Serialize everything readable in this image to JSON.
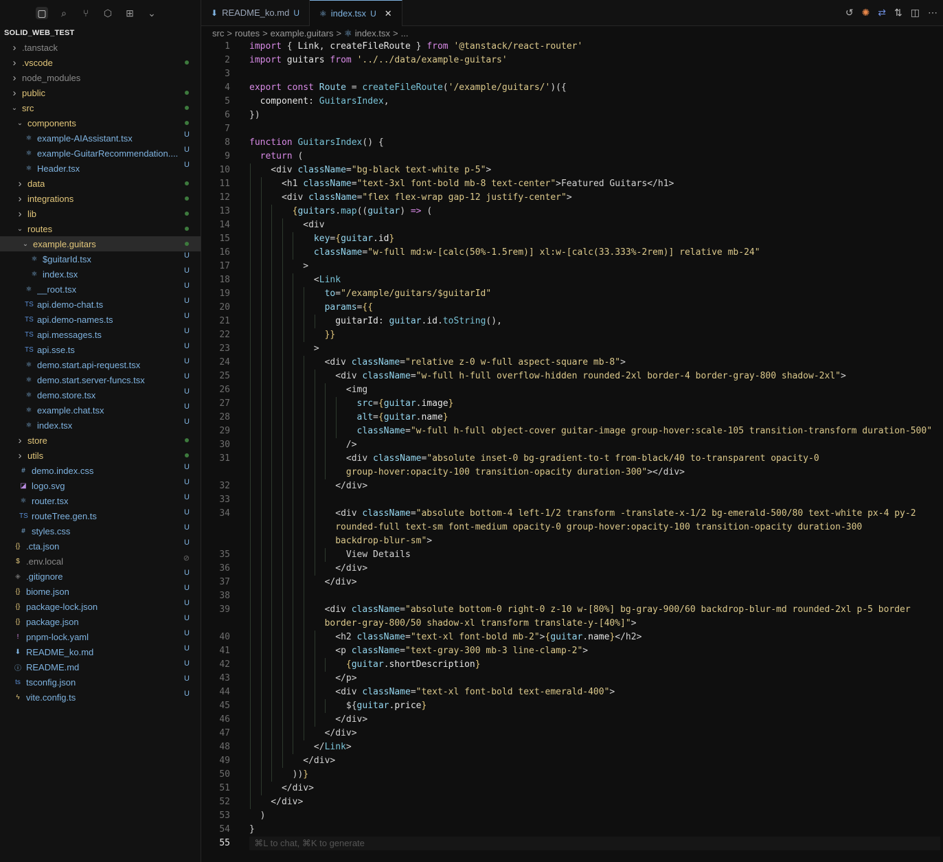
{
  "project": "SOLID_WEB_TEST",
  "tree": [
    {
      "name": ".tanstack",
      "depth": 0,
      "folder": true,
      "open": false,
      "style": "dim",
      "mark": ""
    },
    {
      "name": ".vscode",
      "depth": 0,
      "folder": true,
      "open": false,
      "style": "mod",
      "mark": "dot"
    },
    {
      "name": "node_modules",
      "depth": 0,
      "folder": true,
      "open": false,
      "style": "dim",
      "mark": ""
    },
    {
      "name": "public",
      "depth": 0,
      "folder": true,
      "open": false,
      "style": "mod",
      "mark": "dot"
    },
    {
      "name": "src",
      "depth": 0,
      "folder": true,
      "open": true,
      "style": "mod",
      "mark": "dot"
    },
    {
      "name": "components",
      "depth": 1,
      "folder": true,
      "open": true,
      "style": "mod",
      "mark": "dot"
    },
    {
      "name": "example-AIAssistant.tsx",
      "depth": 2,
      "folder": false,
      "icon": "⚛",
      "style": "new",
      "mark": "U"
    },
    {
      "name": "example-GuitarRecommendation....",
      "depth": 2,
      "folder": false,
      "icon": "⚛",
      "style": "new",
      "mark": "U"
    },
    {
      "name": "Header.tsx",
      "depth": 2,
      "folder": false,
      "icon": "⚛",
      "style": "new",
      "mark": "U"
    },
    {
      "name": "data",
      "depth": 1,
      "folder": true,
      "open": false,
      "style": "mod",
      "mark": "dot"
    },
    {
      "name": "integrations",
      "depth": 1,
      "folder": true,
      "open": false,
      "style": "mod",
      "mark": "dot"
    },
    {
      "name": "lib",
      "depth": 1,
      "folder": true,
      "open": false,
      "style": "mod",
      "mark": "dot"
    },
    {
      "name": "routes",
      "depth": 1,
      "folder": true,
      "open": true,
      "style": "mod",
      "mark": "dot"
    },
    {
      "name": "example.guitars",
      "depth": 2,
      "folder": true,
      "open": true,
      "style": "mod",
      "mark": "dot",
      "selected": true
    },
    {
      "name": "$guitarId.tsx",
      "depth": 3,
      "folder": false,
      "icon": "⚛",
      "style": "new",
      "mark": "U"
    },
    {
      "name": "index.tsx",
      "depth": 3,
      "folder": false,
      "icon": "⚛",
      "style": "new",
      "mark": "U"
    },
    {
      "name": "__root.tsx",
      "depth": 2,
      "folder": false,
      "icon": "⚛",
      "style": "new",
      "mark": "U"
    },
    {
      "name": "api.demo-chat.ts",
      "depth": 2,
      "folder": false,
      "icon": "TS",
      "style": "new",
      "mark": "U"
    },
    {
      "name": "api.demo-names.ts",
      "depth": 2,
      "folder": false,
      "icon": "TS",
      "style": "new",
      "mark": "U"
    },
    {
      "name": "api.messages.ts",
      "depth": 2,
      "folder": false,
      "icon": "TS",
      "style": "new",
      "mark": "U"
    },
    {
      "name": "api.sse.ts",
      "depth": 2,
      "folder": false,
      "icon": "TS",
      "style": "new",
      "mark": "U"
    },
    {
      "name": "demo.start.api-request.tsx",
      "depth": 2,
      "folder": false,
      "icon": "⚛",
      "style": "new",
      "mark": "U"
    },
    {
      "name": "demo.start.server-funcs.tsx",
      "depth": 2,
      "folder": false,
      "icon": "⚛",
      "style": "new",
      "mark": "U"
    },
    {
      "name": "demo.store.tsx",
      "depth": 2,
      "folder": false,
      "icon": "⚛",
      "style": "new",
      "mark": "U"
    },
    {
      "name": "example.chat.tsx",
      "depth": 2,
      "folder": false,
      "icon": "⚛",
      "style": "new",
      "mark": "U"
    },
    {
      "name": "index.tsx",
      "depth": 2,
      "folder": false,
      "icon": "⚛",
      "style": "new",
      "mark": "U"
    },
    {
      "name": "store",
      "depth": 1,
      "folder": true,
      "open": false,
      "style": "mod",
      "mark": "dot"
    },
    {
      "name": "utils",
      "depth": 1,
      "folder": true,
      "open": false,
      "style": "mod",
      "mark": "dot"
    },
    {
      "name": "demo.index.css",
      "depth": 1,
      "folder": false,
      "icon": "#",
      "style": "new",
      "mark": "U"
    },
    {
      "name": "logo.svg",
      "depth": 1,
      "folder": false,
      "icon": "◪",
      "style": "new",
      "mark": "U"
    },
    {
      "name": "router.tsx",
      "depth": 1,
      "folder": false,
      "icon": "⚛",
      "style": "new",
      "mark": "U"
    },
    {
      "name": "routeTree.gen.ts",
      "depth": 1,
      "folder": false,
      "icon": "TS",
      "style": "new",
      "mark": "U"
    },
    {
      "name": "styles.css",
      "depth": 1,
      "folder": false,
      "icon": "#",
      "style": "new",
      "mark": "U"
    },
    {
      "name": ".cta.json",
      "depth": 0,
      "folder": false,
      "icon": "{}",
      "style": "new",
      "mark": "U"
    },
    {
      "name": ".env.local",
      "depth": 0,
      "folder": false,
      "icon": "$",
      "style": "dim",
      "mark": "⊘"
    },
    {
      "name": ".gitignore",
      "depth": 0,
      "folder": false,
      "icon": "◈",
      "style": "new",
      "mark": "U"
    },
    {
      "name": "biome.json",
      "depth": 0,
      "folder": false,
      "icon": "{}",
      "style": "new",
      "mark": "U"
    },
    {
      "name": "package-lock.json",
      "depth": 0,
      "folder": false,
      "icon": "{}",
      "style": "new",
      "mark": "U"
    },
    {
      "name": "package.json",
      "depth": 0,
      "folder": false,
      "icon": "{}",
      "style": "new",
      "mark": "U"
    },
    {
      "name": "pnpm-lock.yaml",
      "depth": 0,
      "folder": false,
      "icon": "!",
      "style": "new",
      "mark": "U"
    },
    {
      "name": "README_ko.md",
      "depth": 0,
      "folder": false,
      "icon": "⬇",
      "style": "new",
      "mark": "U"
    },
    {
      "name": "README.md",
      "depth": 0,
      "folder": false,
      "icon": "ⓘ",
      "style": "new",
      "mark": "U"
    },
    {
      "name": "tsconfig.json",
      "depth": 0,
      "folder": false,
      "icon": "ts",
      "style": "new",
      "mark": "U"
    },
    {
      "name": "vite.config.ts",
      "depth": 0,
      "folder": false,
      "icon": "ϟ",
      "style": "new",
      "mark": "U"
    }
  ],
  "tabs": [
    {
      "label": "README_ko.md",
      "badge": "U",
      "active": false,
      "icon": "⬇"
    },
    {
      "label": "index.tsx",
      "badge": "U",
      "active": true,
      "icon": "⚛"
    }
  ],
  "breadcrumb": [
    "src",
    ">",
    "routes",
    ">",
    "example.guitars",
    ">",
    "⚛",
    "index.tsx",
    ">",
    "..."
  ],
  "hint": "⌘L to chat, ⌘K to generate",
  "current_line": "55",
  "code": [
    {
      "n": "1",
      "html": "<span class='k'>import</span> { <span class='v'>Link</span>, <span class='v'>createFileRoute</span> } <span class='k'>from</span> <span class='s'>'@tanstack/react-router'</span>"
    },
    {
      "n": "2",
      "html": "<span class='k'>import</span> <span class='v'>guitars</span> <span class='k'>from</span> <span class='s'>'../../data/example-guitars'</span>"
    },
    {
      "n": "3",
      "html": ""
    },
    {
      "n": "4",
      "html": "<span class='k'>export</span> <span class='k'>const</span> <span class='a'>Route</span> = <span class='f'>createFileRoute</span>(<span class='s'>'/example/guitars/'</span>)({"
    },
    {
      "n": "5",
      "html": "  <span class='v'>component</span>: <span class='f'>GuitarsIndex</span>,"
    },
    {
      "n": "6",
      "html": "})"
    },
    {
      "n": "7",
      "html": ""
    },
    {
      "n": "8",
      "html": "<span class='k'>function</span> <span class='f'>GuitarsIndex</span>() {"
    },
    {
      "n": "9",
      "html": "  <span class='k'>return</span> ("
    },
    {
      "n": "10",
      "html": "    &lt;<span class='t'>div</span> <span class='a'>className</span>=<span class='s'>\"bg-black text-white p-5\"</span>&gt;"
    },
    {
      "n": "11",
      "html": "      &lt;<span class='t'>h1</span> <span class='a'>className</span>=<span class='s'>\"text-3xl font-bold mb-8 text-center\"</span>&gt;Featured Guitars&lt;/<span class='t'>h1</span>&gt;"
    },
    {
      "n": "12",
      "html": "      &lt;<span class='t'>div</span> <span class='a'>className</span>=<span class='s'>\"flex flex-wrap gap-12 justify-center\"</span>&gt;"
    },
    {
      "n": "13",
      "html": "        <span class='p'>{</span><span class='a'>guitars</span>.<span class='f'>map</span>((<span class='a'>guitar</span>) <span class='k'>=&gt;</span> ("
    },
    {
      "n": "14",
      "html": "          &lt;<span class='t'>div</span>"
    },
    {
      "n": "15",
      "html": "            <span class='a'>key</span>=<span class='p'>{</span><span class='a'>guitar</span>.<span class='v'>id</span><span class='p'>}</span>"
    },
    {
      "n": "16",
      "html": "            <span class='a'>className</span>=<span class='s'>\"w-full md:w-[calc(50%-1.5rem)] xl:w-[calc(33.333%-2rem)] relative mb-24\"</span>"
    },
    {
      "n": "17",
      "html": "          &gt;"
    },
    {
      "n": "18",
      "html": "            &lt;<span class='f'>Link</span>"
    },
    {
      "n": "19",
      "html": "              <span class='a'>to</span>=<span class='s'>\"/example/guitars/$guitarId\"</span>"
    },
    {
      "n": "20",
      "html": "              <span class='a'>params</span>=<span class='p'>{{</span>"
    },
    {
      "n": "21",
      "html": "                <span class='v'>guitarId</span>: <span class='a'>guitar</span>.<span class='v'>id</span>.<span class='f'>toString</span>(),"
    },
    {
      "n": "22",
      "html": "              <span class='p'>}}</span>"
    },
    {
      "n": "23",
      "html": "            &gt;"
    },
    {
      "n": "24",
      "html": "              &lt;<span class='t'>div</span> <span class='a'>className</span>=<span class='s'>\"relative z-0 w-full aspect-square mb-8\"</span>&gt;"
    },
    {
      "n": "25",
      "html": "                &lt;<span class='t'>div</span> <span class='a'>className</span>=<span class='s'>\"w-full h-full overflow-hidden rounded-2xl border-4 border-gray-800 shadow-2xl\"</span>&gt;"
    },
    {
      "n": "26",
      "html": "                  &lt;<span class='t'>img</span>"
    },
    {
      "n": "27",
      "html": "                    <span class='a'>src</span>=<span class='p'>{</span><span class='a'>guitar</span>.<span class='v'>image</span><span class='p'>}</span>"
    },
    {
      "n": "28",
      "html": "                    <span class='a'>alt</span>=<span class='p'>{</span><span class='a'>guitar</span>.<span class='v'>name</span><span class='p'>}</span>"
    },
    {
      "n": "29",
      "html": "                    <span class='a'>className</span>=<span class='s'>\"w-full h-full object-cover guitar-image group-hover:scale-105 transition-transform duration-500\"</span>"
    },
    {
      "n": "30",
      "html": "                  /&gt;"
    },
    {
      "n": "31",
      "html": "                  &lt;<span class='t'>div</span> <span class='a'>className</span>=<span class='s'>\"absolute inset-0 bg-gradient-to-t from-black/40 to-transparent opacity-0</span>"
    },
    {
      "n": "",
      "html": "                  <span class='s'>group-hover:opacity-100 transition-opacity duration-300\"</span>&gt;&lt;/<span class='t'>div</span>&gt;"
    },
    {
      "n": "32",
      "html": "                &lt;/<span class='t'>div</span>&gt;"
    },
    {
      "n": "33",
      "html": ""
    },
    {
      "n": "34",
      "html": "                &lt;<span class='t'>div</span> <span class='a'>className</span>=<span class='s'>\"absolute bottom-4 left-1/2 transform -translate-x-1/2 bg-emerald-500/80 text-white px-4 py-2</span>"
    },
    {
      "n": "",
      "html": "                <span class='s'>rounded-full text-sm font-medium opacity-0 group-hover:opacity-100 transition-opacity duration-300</span>"
    },
    {
      "n": "",
      "html": "                <span class='s'>backdrop-blur-sm\"</span>&gt;"
    },
    {
      "n": "35",
      "html": "                  View Details"
    },
    {
      "n": "36",
      "html": "                &lt;/<span class='t'>div</span>&gt;"
    },
    {
      "n": "37",
      "html": "              &lt;/<span class='t'>div</span>&gt;"
    },
    {
      "n": "38",
      "html": ""
    },
    {
      "n": "39",
      "html": "              &lt;<span class='t'>div</span> <span class='a'>className</span>=<span class='s'>\"absolute bottom-0 right-0 z-10 w-[80%] bg-gray-900/60 backdrop-blur-md rounded-2xl p-5 border</span>"
    },
    {
      "n": "",
      "html": "              <span class='s'>border-gray-800/50 shadow-xl transform translate-y-[40%]\"</span>&gt;"
    },
    {
      "n": "40",
      "html": "                &lt;<span class='t'>h2</span> <span class='a'>className</span>=<span class='s'>\"text-xl font-bold mb-2\"</span>&gt;<span class='p'>{</span><span class='a'>guitar</span>.<span class='v'>name</span><span class='p'>}</span>&lt;/<span class='t'>h2</span>&gt;"
    },
    {
      "n": "41",
      "html": "                &lt;<span class='t'>p</span> <span class='a'>className</span>=<span class='s'>\"text-gray-300 mb-3 line-clamp-2\"</span>&gt;"
    },
    {
      "n": "42",
      "html": "                  <span class='p'>{</span><span class='a'>guitar</span>.<span class='v'>shortDescription</span><span class='p'>}</span>"
    },
    {
      "n": "43",
      "html": "                &lt;/<span class='t'>p</span>&gt;"
    },
    {
      "n": "44",
      "html": "                &lt;<span class='t'>div</span> <span class='a'>className</span>=<span class='s'>\"text-xl font-bold text-emerald-400\"</span>&gt;"
    },
    {
      "n": "45",
      "html": "                  ${<span class='a'>guitar</span>.<span class='v'>price</span><span class='p'>}</span>"
    },
    {
      "n": "46",
      "html": "                &lt;/<span class='t'>div</span>&gt;"
    },
    {
      "n": "47",
      "html": "              &lt;/<span class='t'>div</span>&gt;"
    },
    {
      "n": "48",
      "html": "            &lt;/<span class='f'>Link</span>&gt;"
    },
    {
      "n": "49",
      "html": "          &lt;/<span class='t'>div</span>&gt;"
    },
    {
      "n": "50",
      "html": "        ))<span class='p'>}</span>"
    },
    {
      "n": "51",
      "html": "      &lt;/<span class='t'>div</span>&gt;"
    },
    {
      "n": "52",
      "html": "    &lt;/<span class='t'>div</span>&gt;"
    },
    {
      "n": "53",
      "html": "  )"
    },
    {
      "n": "54",
      "html": "}"
    },
    {
      "n": "55",
      "html": "",
      "hint": true
    }
  ]
}
